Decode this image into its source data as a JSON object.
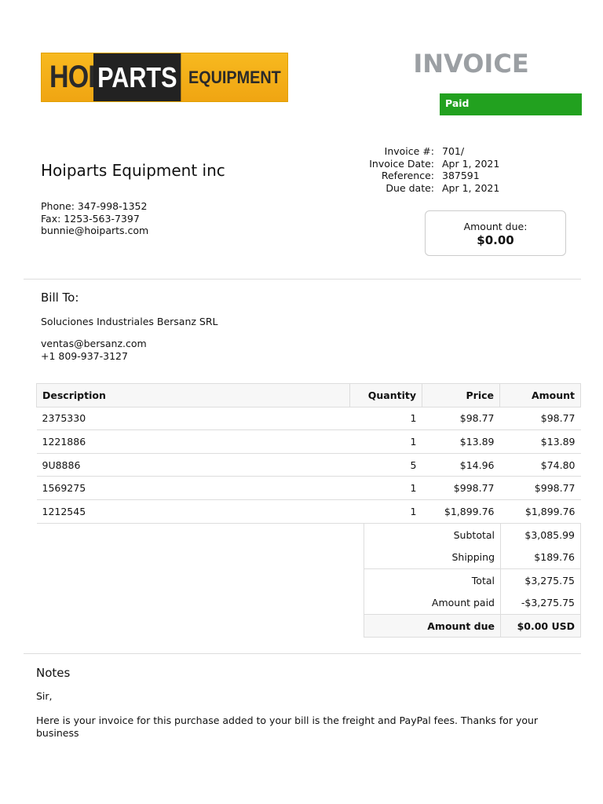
{
  "logo": {
    "word1": "HOI",
    "word2": "PARTS",
    "word3": "EQUIPMENT"
  },
  "title": "INVOICE",
  "status": "Paid",
  "colors": {
    "status": "#22a11f",
    "title": "#9b9fa3",
    "logo_bg": "#f7b91f"
  },
  "meta": [
    {
      "label": "Invoice #:",
      "value": "701/"
    },
    {
      "label": "Invoice Date:",
      "value": "Apr 1, 2021"
    },
    {
      "label": "Reference:",
      "value": "387591"
    },
    {
      "label": "Due date:",
      "value": "Apr 1, 2021"
    }
  ],
  "company": {
    "name": "Hoiparts Equipment inc",
    "phone": "Phone: 347-998-1352",
    "fax": "Fax: 1253-563-7397",
    "email": "bunnie@hoiparts.com"
  },
  "amount_due_box": {
    "label": "Amount due:",
    "value": "$0.00"
  },
  "bill_to": {
    "heading": "Bill To:",
    "name": "Soluciones Industriales Bersanz SRL",
    "email": "ventas@bersanz.com",
    "phone": "+1 809-937-3127"
  },
  "table": {
    "headers": [
      "Description",
      "Quantity",
      "Price",
      "Amount"
    ],
    "rows": [
      [
        "2375330",
        "1",
        "$98.77",
        "$98.77"
      ],
      [
        "1221886",
        "1",
        "$13.89",
        "$13.89"
      ],
      [
        "9U8886",
        "5",
        "$14.96",
        "$74.80"
      ],
      [
        "1569275",
        "1",
        "$998.77",
        "$998.77"
      ],
      [
        "1212545",
        "1",
        "$1,899.76",
        "$1,899.76"
      ]
    ]
  },
  "totals": [
    {
      "label": "Subtotal",
      "value": "$3,085.99"
    },
    {
      "label": "Shipping",
      "value": "$189.76"
    },
    {
      "label": "Total",
      "value": "$3,275.75"
    },
    {
      "label": "Amount paid",
      "value": "-$3,275.75"
    },
    {
      "label": "Amount due",
      "value": "$0.00 USD"
    }
  ],
  "notes": {
    "heading": "Notes",
    "salutation": "Sir,",
    "body": "Here is your invoice for this purchase added to your bill is the freight and PayPal fees. Thanks for your business"
  }
}
